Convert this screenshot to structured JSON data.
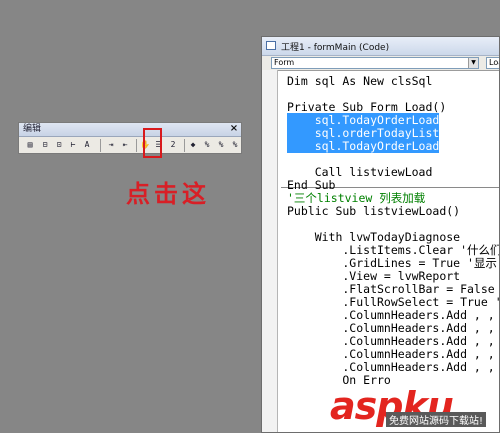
{
  "toolbar": {
    "title": "编辑",
    "close_glyph": "×",
    "buttons": [
      {
        "name": "list-properties-icon",
        "glyph": "▤"
      },
      {
        "name": "list-constants-icon",
        "glyph": "⊟"
      },
      {
        "name": "quick-info-icon",
        "glyph": "⊡"
      },
      {
        "name": "parameter-info-icon",
        "glyph": "⊢"
      },
      {
        "name": "complete-word-icon",
        "glyph": "A"
      },
      {
        "name": "indent-icon",
        "glyph": "⇥"
      },
      {
        "name": "outdent-icon",
        "glyph": "⇤"
      },
      {
        "name": "toggle-breakpoint-icon",
        "glyph": "✋"
      },
      {
        "name": "comment-block-icon",
        "glyph": "☰"
      },
      {
        "name": "uncomment-block-icon",
        "glyph": "2"
      },
      {
        "name": "toggle-bookmark-icon",
        "glyph": "◆"
      },
      {
        "name": "next-bookmark-icon",
        "glyph": "%"
      },
      {
        "name": "previous-bookmark-icon",
        "glyph": "%"
      },
      {
        "name": "clear-bookmarks-icon",
        "glyph": "%"
      }
    ]
  },
  "annotation": {
    "text": "点击这",
    "color": "#d81f26"
  },
  "code_window": {
    "title": "工程1 - formMain (Code)",
    "object_combo": "Form",
    "procedure_combo": "Load",
    "lines": [
      {
        "text": "Dim sql As New clsSql",
        "kind": "normal"
      },
      {
        "text": "",
        "kind": "normal"
      },
      {
        "text": "Private Sub Form_Load()",
        "kind": "normal"
      },
      {
        "text": "    sql.TodayOrderLoad",
        "kind": "selected"
      },
      {
        "text": "    sql.orderTodayList",
        "kind": "selected"
      },
      {
        "text": "    sql.TodayOrderLoad",
        "kind": "selected"
      },
      {
        "text": "",
        "kind": "normal"
      },
      {
        "text": "    Call listviewLoad",
        "kind": "normal"
      },
      {
        "text": "End Sub",
        "kind": "normal"
      },
      {
        "text": "'三个listview 列表加载",
        "kind": "comment"
      },
      {
        "text": "Public Sub listviewLoad()",
        "kind": "normal"
      },
      {
        "text": "",
        "kind": "normal"
      },
      {
        "text": "    With lvwTodayDiagnose",
        "kind": "normal"
      },
      {
        "text": "        .ListItems.Clear '什么们",
        "kind": "normal"
      },
      {
        "text": "        .GridLines = True '显示",
        "kind": "normal"
      },
      {
        "text": "        .View = lvwReport",
        "kind": "normal"
      },
      {
        "text": "        .FlatScrollBar = False",
        "kind": "normal"
      },
      {
        "text": "        .FullRowSelect = True '",
        "kind": "normal"
      },
      {
        "text": "        .ColumnHeaders.Add , ,",
        "kind": "normal"
      },
      {
        "text": "        .ColumnHeaders.Add , ,",
        "kind": "normal"
      },
      {
        "text": "        .ColumnHeaders.Add , ,",
        "kind": "normal"
      },
      {
        "text": "        .ColumnHeaders.Add , ,",
        "kind": "normal"
      },
      {
        "text": "        .ColumnHeaders.Add , ,",
        "kind": "normal"
      },
      {
        "text": "        On Erro",
        "kind": "normal"
      }
    ]
  },
  "watermark": {
    "main": "aspku",
    "sub": "免费网站源码下载站!"
  },
  "colors": {
    "selection": "#3399ff",
    "highlight_box": "#d8191c",
    "background": "#868686"
  }
}
